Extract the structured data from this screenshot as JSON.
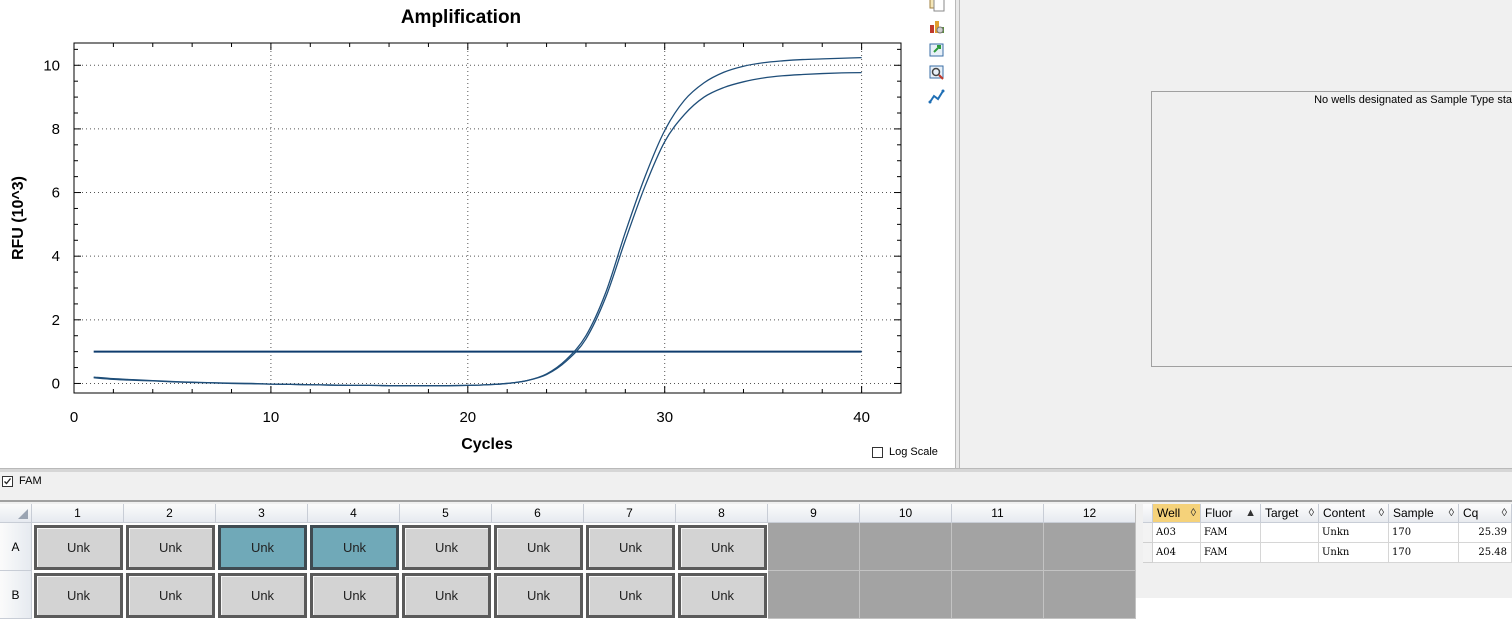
{
  "chart_panel": {
    "toolbar_icons": [
      "copy-icon",
      "chart-settings-icon",
      "export-icon",
      "zoom-icon",
      "line-chart-icon"
    ],
    "log_scale_label": "Log Scale",
    "log_scale_checked": false
  },
  "chart_data": {
    "type": "line",
    "title": "Amplification",
    "xlabel": "Cycles",
    "ylabel": "RFU (10^3)",
    "xlim": [
      0,
      42
    ],
    "ylim": [
      -0.3,
      10.7
    ],
    "xticks": [
      0,
      10,
      20,
      30,
      40
    ],
    "yticks": [
      0,
      2,
      4,
      6,
      8,
      10
    ],
    "grid": true,
    "threshold": 1.0,
    "colors": {
      "series": "#1f4e79",
      "threshold": "#0f3c6e"
    },
    "series": [
      {
        "well": "A03",
        "x": [
          1,
          2,
          3,
          4,
          5,
          6,
          7,
          8,
          9,
          10,
          11,
          12,
          13,
          14,
          15,
          16,
          17,
          18,
          19,
          20,
          21,
          22,
          23,
          24,
          25,
          26,
          27,
          28,
          29,
          30,
          31,
          32,
          33,
          34,
          35,
          36,
          37,
          38,
          39,
          40
        ],
        "values": [
          0.2,
          0.15,
          0.12,
          0.09,
          0.06,
          0.04,
          0.02,
          0.01,
          0.0,
          -0.02,
          -0.03,
          -0.04,
          -0.05,
          -0.06,
          -0.06,
          -0.07,
          -0.07,
          -0.07,
          -0.07,
          -0.06,
          -0.04,
          0.0,
          0.09,
          0.3,
          0.75,
          1.5,
          2.85,
          4.75,
          6.5,
          7.95,
          8.9,
          9.45,
          9.78,
          9.97,
          10.08,
          10.14,
          10.18,
          10.2,
          10.22,
          10.24
        ]
      },
      {
        "well": "A04",
        "x": [
          1,
          2,
          3,
          4,
          5,
          6,
          7,
          8,
          9,
          10,
          11,
          12,
          13,
          14,
          15,
          16,
          17,
          18,
          19,
          20,
          21,
          22,
          23,
          24,
          25,
          26,
          27,
          28,
          29,
          30,
          31,
          32,
          33,
          34,
          35,
          36,
          37,
          38,
          39,
          40
        ],
        "values": [
          0.18,
          0.13,
          0.1,
          0.08,
          0.05,
          0.03,
          0.02,
          0.0,
          -0.01,
          -0.02,
          -0.03,
          -0.04,
          -0.05,
          -0.06,
          -0.06,
          -0.07,
          -0.07,
          -0.07,
          -0.07,
          -0.06,
          -0.04,
          0.0,
          0.09,
          0.28,
          0.7,
          1.4,
          2.7,
          4.5,
          6.2,
          7.6,
          8.45,
          9.0,
          9.3,
          9.48,
          9.6,
          9.67,
          9.71,
          9.74,
          9.76,
          9.77
        ]
      }
    ]
  },
  "std_curve": {
    "message": "No wells designated as Sample Type sta"
  },
  "fluor_filter": {
    "label": "FAM",
    "checked": true
  },
  "plate": {
    "columns": [
      "1",
      "2",
      "3",
      "4",
      "5",
      "6",
      "7",
      "8",
      "9",
      "10",
      "11",
      "12"
    ],
    "rows": [
      {
        "label": "A",
        "wells": [
          "Unk",
          "Unk",
          "Unk",
          "Unk",
          "Unk",
          "Unk",
          "Unk",
          "Unk",
          "",
          "",
          "",
          ""
        ],
        "selected": [
          3,
          4
        ]
      },
      {
        "label": "B",
        "wells": [
          "Unk",
          "Unk",
          "Unk",
          "Unk",
          "Unk",
          "Unk",
          "Unk",
          "Unk",
          "",
          "",
          "",
          ""
        ],
        "selected": []
      }
    ]
  },
  "results_table": {
    "headers": [
      "Well",
      "Fluor",
      "Target",
      "Content",
      "Sample",
      "Cq"
    ],
    "header_sort_icons": [
      "◊",
      "▲",
      "◊",
      "◊",
      "◊",
      "◊"
    ],
    "rows": [
      [
        "A03",
        "FAM",
        "",
        "Unkn",
        "170",
        "25.39"
      ],
      [
        "A04",
        "FAM",
        "",
        "Unkn",
        "170",
        "25.48"
      ]
    ]
  }
}
